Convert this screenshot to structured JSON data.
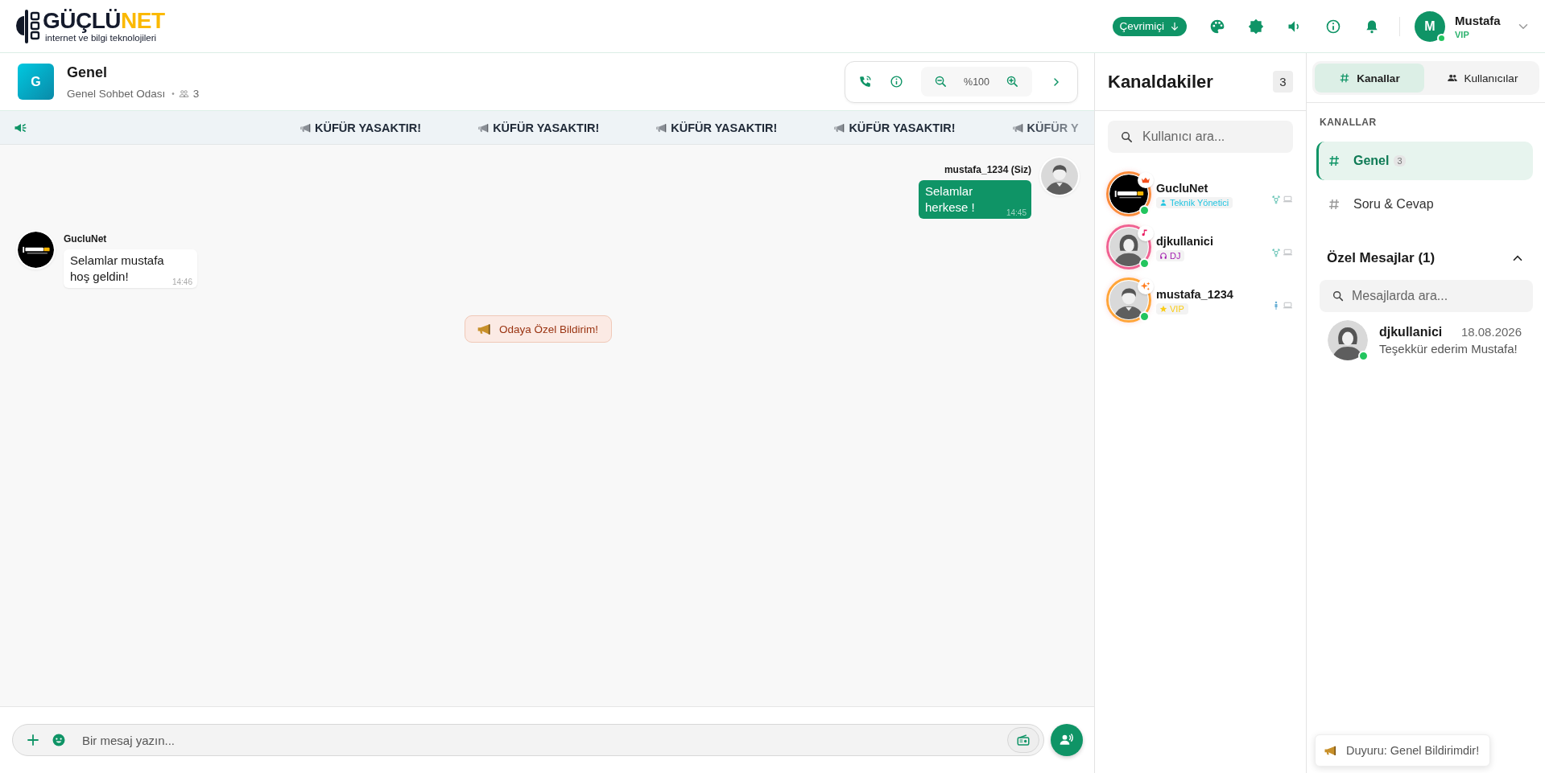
{
  "brand": {
    "name": "GÜÇLÜ",
    "name_accent": "NET",
    "tagline": "internet ve bilgi teknolojileri"
  },
  "topbar": {
    "status": "Çevrimiçi",
    "user": {
      "initial": "M",
      "name": "Mustafa",
      "rank": "VIP",
      "online": true
    }
  },
  "room": {
    "initial": "G",
    "title": "Genel",
    "subtitle": "Genel Sohbet Odası",
    "separator": "•",
    "member_count": "3",
    "zoom": "%100"
  },
  "ticker": [
    "KÜFÜR YASAKTIR!",
    "KÜFÜR YASAKTIR!",
    "KÜFÜR YASAKTIR!",
    "KÜFÜR YASAKTIR!",
    "KÜFÜR Y"
  ],
  "messages": [
    {
      "kind": "own",
      "author": "mustafa_1234 (Siz)",
      "text": "Selamlar herkese !",
      "time": "14:45"
    },
    {
      "kind": "other",
      "author": "GucluNet",
      "text": "Selamlar mustafa hoş geldin!",
      "time": "14:46"
    },
    {
      "kind": "notice",
      "text": "Odaya Özel Bildirim!"
    }
  ],
  "composer": {
    "placeholder": "Bir mesaj yazın..."
  },
  "members": {
    "title": "Kanaldakiler",
    "count": "3",
    "search_placeholder": "Kullanıcı ara...",
    "items": [
      {
        "kind": "admin",
        "name": "GucluNet",
        "role": "Teknik Yönetici",
        "color": "#22c4e0",
        "online": true
      },
      {
        "kind": "dj",
        "name": "djkullanici",
        "role": "DJ",
        "color": "#a21caf",
        "online": true
      },
      {
        "kind": "vip",
        "name": "mustafa_1234",
        "role": "VIP",
        "color": "#facc15",
        "online": true
      }
    ]
  },
  "sidebar": {
    "tabs": [
      {
        "label": "Kanallar",
        "selected": true
      },
      {
        "label": "Kullanıcılar",
        "selected": false
      }
    ],
    "section": "KANALLAR",
    "channels": [
      {
        "name": "Genel",
        "count": "3",
        "selected": true
      },
      {
        "name": "Soru & Cevap",
        "selected": false
      }
    ],
    "dm": {
      "title": "Özel Mesajlar (1)",
      "expanded": true,
      "search_placeholder": "Mesajlarda ara...",
      "items": [
        {
          "name": "djkullanici",
          "date": "18.08.2026",
          "preview": "Teşekkür ederim Mustafa!",
          "online": true
        }
      ]
    }
  },
  "toast": {
    "text": "Duyuru: Genel Bildirimdir!"
  }
}
